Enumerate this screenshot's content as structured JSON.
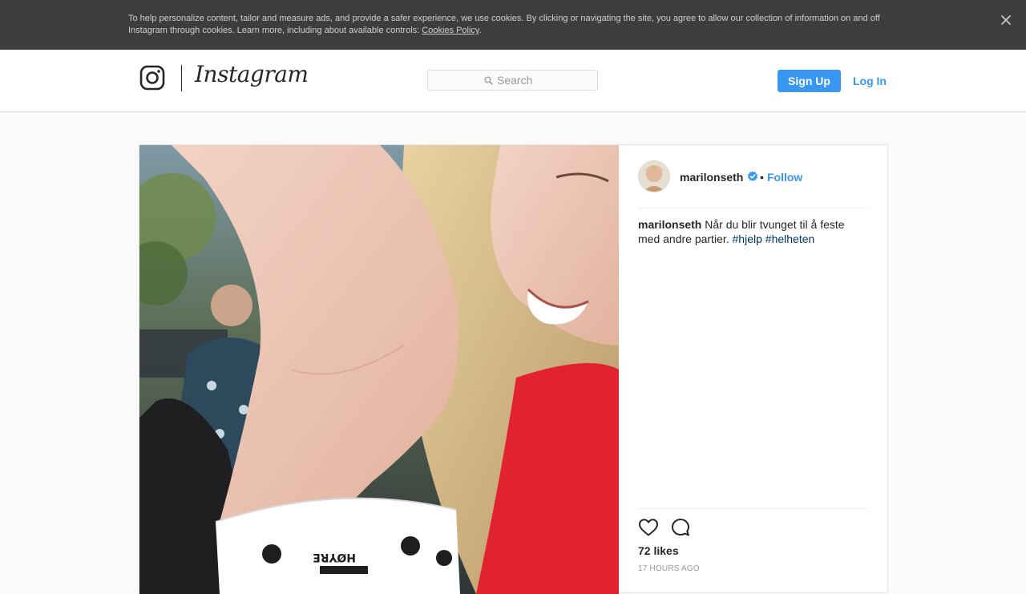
{
  "cookie_banner": {
    "text": "To help personalize content, tailor and measure ads, and provide a safer experience, we use cookies. By clicking or navigating the site, you agree to allow our collection of information on and off Instagram through cookies. Learn more, including about available controls: ",
    "link_label": "Cookies Policy",
    "period": ".",
    "close_icon": "close-icon"
  },
  "header": {
    "logo_icon": "instagram-camera-icon",
    "wordmark": "Instagram",
    "search": {
      "placeholder": "Search",
      "icon": "search-icon"
    },
    "signup_label": "Sign Up",
    "login_label": "Log In"
  },
  "post": {
    "username": "marilonseth",
    "verified_icon": "verified-badge-icon",
    "dot": "•",
    "follow_label": "Follow",
    "caption": {
      "user": "marilonseth",
      "text": " Når du blir tvunget til å feste med andre partier. ",
      "hashtags": [
        "#hjelp",
        "#helheten"
      ]
    },
    "like_icon": "heart-icon",
    "comment_icon": "comment-icon",
    "likes": "72 likes",
    "timestamp": "17 HOURS AGO"
  },
  "colors": {
    "accent": "#3897f0",
    "hashtag": "#003569",
    "banner_bg": "#3d3d3d"
  }
}
